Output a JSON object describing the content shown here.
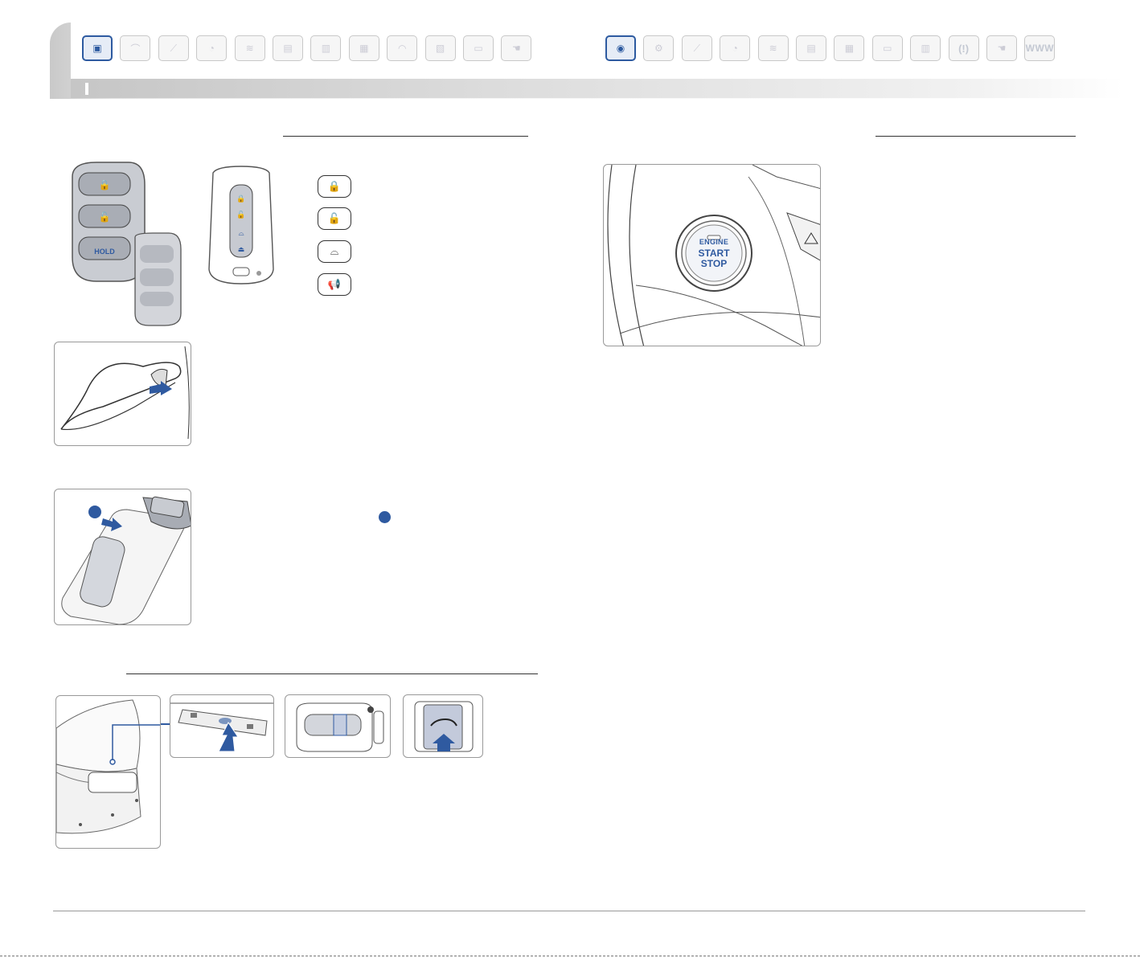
{
  "nav": {
    "left_icons": [
      {
        "name": "smart-key-icon",
        "glyph": "▣",
        "active": true
      },
      {
        "name": "seat-icon",
        "glyph": "⌒",
        "active": false
      },
      {
        "name": "wiper-icon",
        "glyph": "⟋",
        "active": false
      },
      {
        "name": "cluster-icon",
        "glyph": "◔",
        "active": false
      },
      {
        "name": "climate-icon",
        "glyph": "≋",
        "active": false
      },
      {
        "name": "climate-panel-icon",
        "glyph": "▤",
        "active": false
      },
      {
        "name": "audio-icon",
        "glyph": "▥",
        "active": false
      },
      {
        "name": "screen-icon",
        "glyph": "▦",
        "active": false
      },
      {
        "name": "windshield-icon",
        "glyph": "◠",
        "active": false
      },
      {
        "name": "console-icon",
        "glyph": "▧",
        "active": false
      },
      {
        "name": "overhead-icon",
        "glyph": "▭",
        "active": false
      },
      {
        "name": "hand-icon",
        "glyph": "☚",
        "active": false
      }
    ],
    "right_icons": [
      {
        "name": "start-button-icon",
        "glyph": "◉",
        "active": true
      },
      {
        "name": "engine-icon",
        "glyph": "⚙",
        "active": false
      },
      {
        "name": "wiper-stalk-icon",
        "glyph": "⟋",
        "active": false
      },
      {
        "name": "gauge-icon",
        "glyph": "◔",
        "active": false
      },
      {
        "name": "hvac-icon",
        "glyph": "≋",
        "active": false
      },
      {
        "name": "hvac-panel-icon",
        "glyph": "▤",
        "active": false
      },
      {
        "name": "navigation-screen-icon",
        "glyph": "▦",
        "active": false
      },
      {
        "name": "overhead-console-icon",
        "glyph": "▭",
        "active": false
      },
      {
        "name": "radio-icon",
        "glyph": "▥",
        "active": false
      },
      {
        "name": "tpms-icon",
        "glyph": "(!)",
        "active": false
      },
      {
        "name": "hand-gesture-icon",
        "glyph": "☚",
        "active": false
      },
      {
        "name": "www-icon",
        "glyph": "WWW",
        "active": false
      }
    ]
  },
  "remote_legend": [
    {
      "name": "lock-button-icon",
      "glyph": "🔒"
    },
    {
      "name": "unlock-button-icon",
      "glyph": "🔓"
    },
    {
      "name": "trunk-button-icon",
      "glyph": "⌓"
    },
    {
      "name": "panic-button-icon",
      "glyph": "📢"
    }
  ],
  "labels": {
    "remote_hold": "HOLD",
    "start_engine": "ENGINE",
    "start_start": "START",
    "start_stop": "STOP"
  },
  "colors": {
    "accent": "#2f5aa0",
    "fob_light": "#d9dbe0",
    "fob_dark": "#8a8e96"
  }
}
